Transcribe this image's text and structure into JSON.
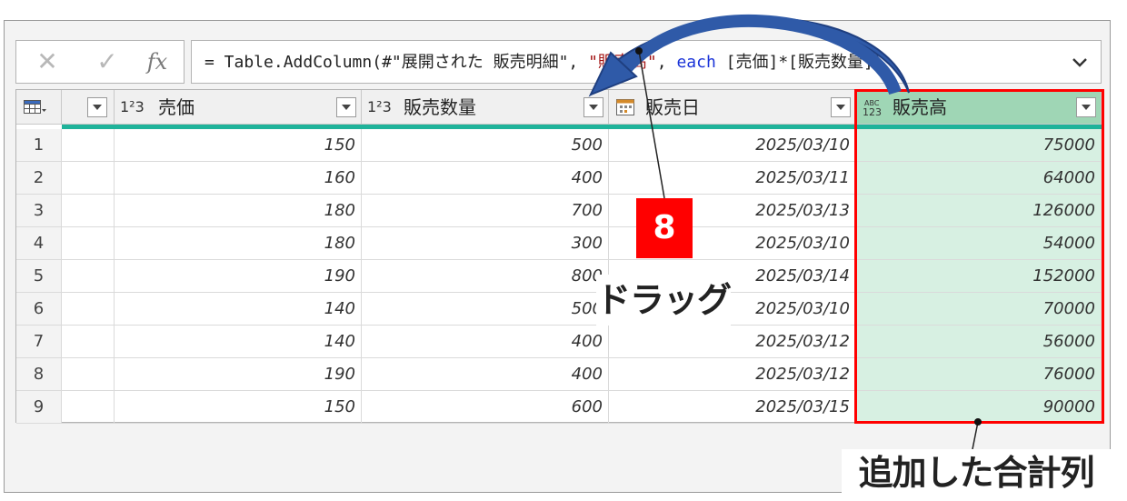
{
  "formula_bar": {
    "cancel_icon": "✕",
    "commit_icon": "✓",
    "fx_label": "fx",
    "formula_prefix": "= Table.AddColumn(#\"展開された 販売明細\", ",
    "formula_col": "\"販売高\"",
    "formula_sep": ", ",
    "formula_kw": "each",
    "formula_expr": " [売価]*[販売数量])"
  },
  "table": {
    "columns": [
      {
        "label": "売価",
        "type_icon": "1²3"
      },
      {
        "label": "販売数量",
        "type_icon": "1²3"
      },
      {
        "label": "販売日",
        "type_icon": "calendar-icon"
      },
      {
        "label": "販売高",
        "type_icon": "ABC/123"
      }
    ],
    "rows": [
      {
        "num": "1",
        "price": "150",
        "qty": "500",
        "date": "2025/03/10",
        "sales": "75000"
      },
      {
        "num": "2",
        "price": "160",
        "qty": "400",
        "date": "2025/03/11",
        "sales": "64000"
      },
      {
        "num": "3",
        "price": "180",
        "qty": "700",
        "date": "2025/03/13",
        "sales": "126000"
      },
      {
        "num": "4",
        "price": "180",
        "qty": "300",
        "date": "2025/03/10",
        "sales": "54000"
      },
      {
        "num": "5",
        "price": "190",
        "qty": "800",
        "date": "2025/03/14",
        "sales": "152000"
      },
      {
        "num": "6",
        "price": "140",
        "qty": "500",
        "date": "2025/03/10",
        "sales": "70000"
      },
      {
        "num": "7",
        "price": "140",
        "qty": "400",
        "date": "2025/03/12",
        "sales": "56000"
      },
      {
        "num": "8",
        "price": "190",
        "qty": "400",
        "date": "2025/03/12",
        "sales": "76000"
      },
      {
        "num": "9",
        "price": "150",
        "qty": "600",
        "date": "2025/03/15",
        "sales": "90000"
      }
    ]
  },
  "annotations": {
    "step_number": "8",
    "drag_label": "ドラッグ",
    "added_label": "追加した合計列"
  },
  "colors": {
    "accent_red": "#ff0000",
    "quality_bar": "#1fb39a",
    "selected_header": "#9fd6b5",
    "selected_cells": "#d7f0e2",
    "arrow_blue": "#2f5aa8"
  }
}
